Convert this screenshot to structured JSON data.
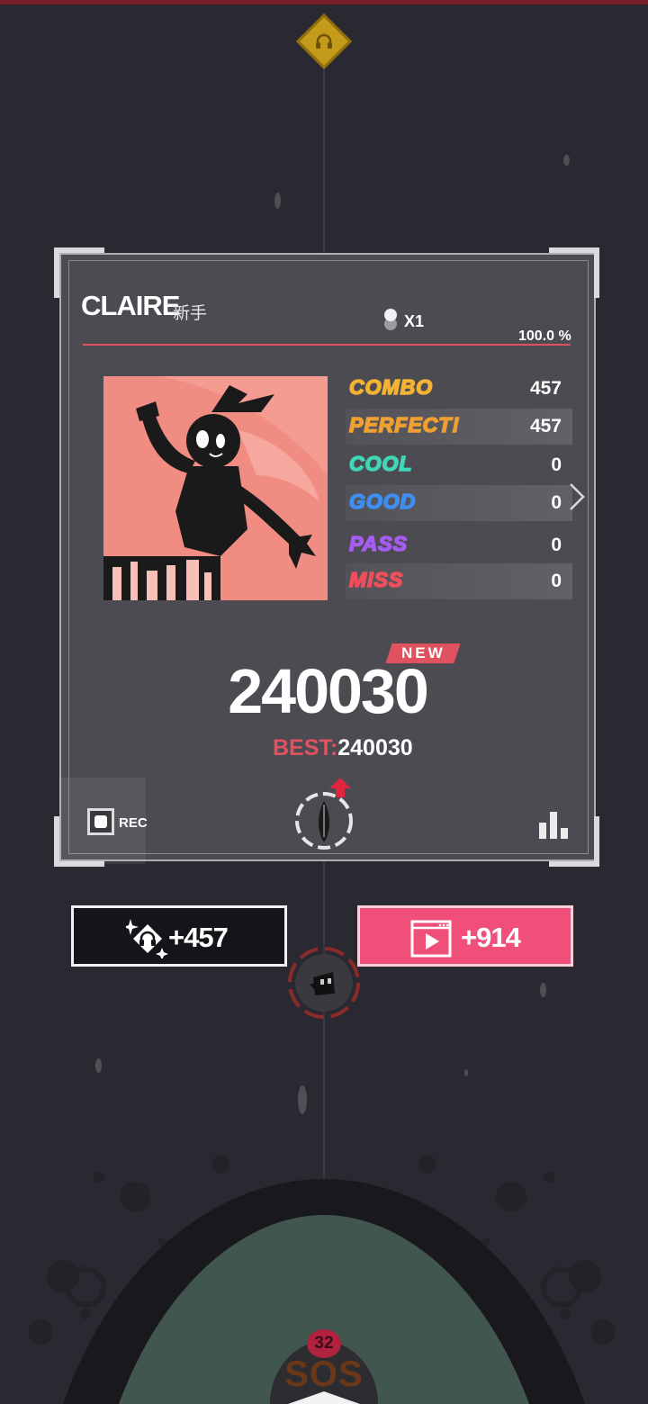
{
  "result": {
    "player_name": "CLAIRE",
    "player_rank": "新手",
    "multiplier": "X1",
    "accuracy_text": "100.0 %",
    "accuracy_fraction": 1.0,
    "stats": [
      {
        "label": "COMBO",
        "value": "457",
        "color": "#f2b233"
      },
      {
        "label": "PERFECT!",
        "value": "457",
        "color": "#f0a030"
      },
      {
        "label": "COOL",
        "value": "0",
        "color": "#3fd6b6"
      },
      {
        "label": "GOOD",
        "value": "0",
        "color": "#3f8ef0"
      },
      {
        "label": "PASS",
        "value": "0",
        "color": "#a65cf0"
      },
      {
        "label": "MISS",
        "value": "0",
        "color": "#ef4f5a"
      }
    ],
    "new_badge": "NEW",
    "score": "240030",
    "best_label": "BEST:",
    "best_value": "240030",
    "rec_label": "REC"
  },
  "rewards": {
    "notes_text": "+457",
    "ad_text": "+914"
  },
  "difficulty": {
    "level": "32",
    "label": "SOS"
  },
  "icons": {
    "top": "headphones-diamond-icon",
    "cover": "album-cover-silhouette",
    "next": "chevron-right-icon",
    "rec": "record-icon",
    "character": "character-badge-icon",
    "rank": "bar-chart-icon",
    "notes": "sparkle-headphones-icon",
    "ad": "video-play-icon",
    "elfin": "elfin-icon"
  },
  "colors": {
    "accent_red": "#e0525f",
    "ad_pink": "#ef4f79",
    "card_bg": "#4c4b52",
    "page_bg": "#2a2931",
    "cover_bg": "#f08c82"
  }
}
